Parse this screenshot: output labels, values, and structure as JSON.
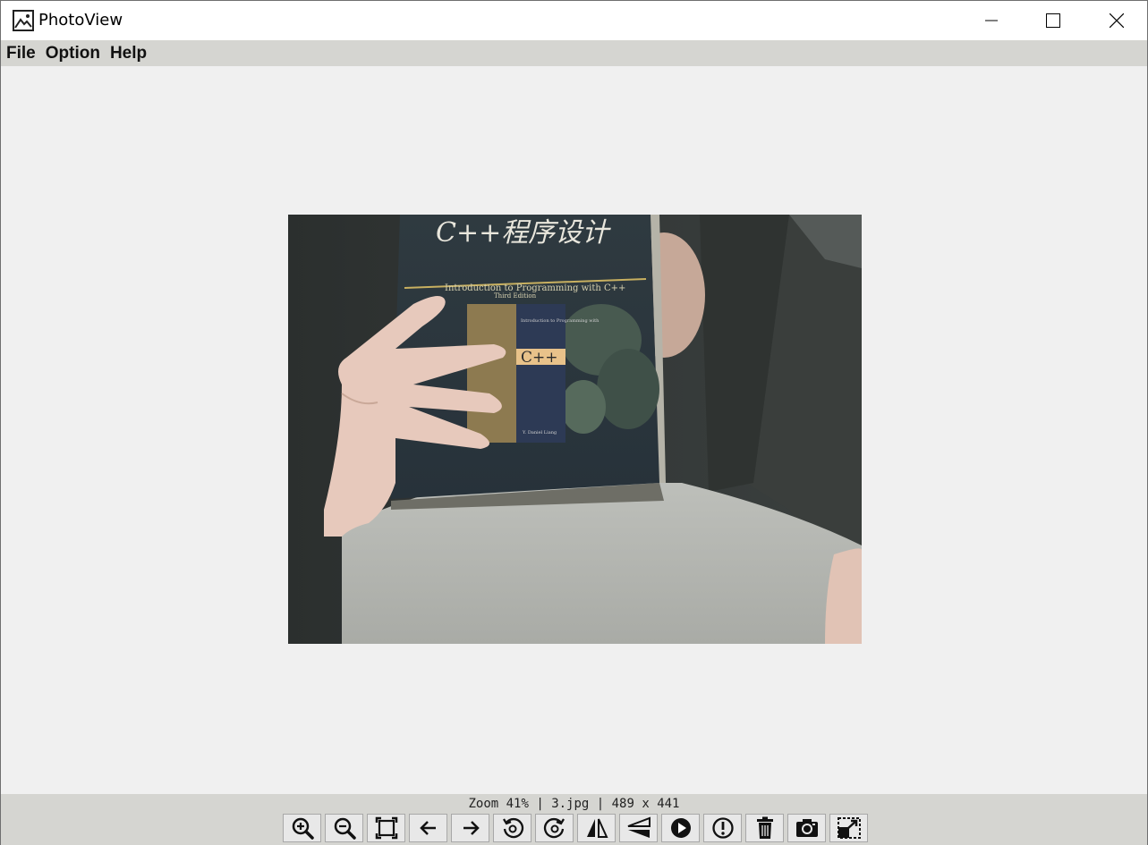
{
  "window": {
    "title": "PhotoView"
  },
  "menu": {
    "items": [
      {
        "label": "File"
      },
      {
        "label": "Option"
      },
      {
        "label": "Help"
      }
    ]
  },
  "status": {
    "text": "Zoom 41% | 3.jpg | 489 x 441",
    "zoom_percent": 41,
    "file_name": "3.jpg",
    "image_size": "489 x 441"
  },
  "photo": {
    "book_title_cn": "C++程序设计",
    "book_subtitle": "Introduction to Programming with C++",
    "edition": "Third Edition",
    "author": "Y. Daniel Liang",
    "inner_cover_title": "Introduction to Programming with",
    "inner_cover_lang": "C++"
  },
  "toolbar": {
    "buttons": [
      {
        "icon": "zoom-in-icon"
      },
      {
        "icon": "zoom-out-icon"
      },
      {
        "icon": "fit-window-icon"
      },
      {
        "icon": "arrow-left-icon"
      },
      {
        "icon": "arrow-right-icon"
      },
      {
        "icon": "rotate-left-icon"
      },
      {
        "icon": "rotate-right-icon"
      },
      {
        "icon": "flip-horizontal-icon"
      },
      {
        "icon": "flip-vertical-icon"
      },
      {
        "icon": "play-icon"
      },
      {
        "icon": "info-icon"
      },
      {
        "icon": "trash-icon"
      },
      {
        "icon": "camera-icon"
      },
      {
        "icon": "resize-icon"
      }
    ]
  }
}
